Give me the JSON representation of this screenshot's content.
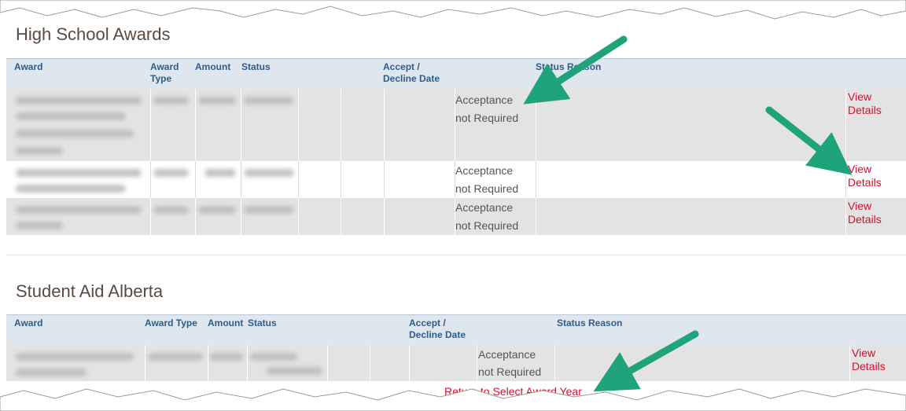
{
  "high_school": {
    "title": "High School Awards",
    "headers": {
      "award": "Award",
      "award_type_1": "Award",
      "award_type_2": "Type",
      "amount": "Amount",
      "status": "Status",
      "accept_1": "Accept /",
      "accept_2": "Decline Date",
      "status_reason": "Status Reason"
    },
    "rows": [
      {
        "acceptance_1": "Acceptance",
        "acceptance_2": "not Required",
        "link_1": "View",
        "link_2": "Details"
      },
      {
        "acceptance_1": "Acceptance",
        "acceptance_2": "not Required",
        "link_1": "View",
        "link_2": "Details"
      },
      {
        "acceptance_1": "Acceptance",
        "acceptance_2": "not Required",
        "link_1": "View",
        "link_2": "Details"
      }
    ]
  },
  "student_aid": {
    "title": "Student Aid Alberta",
    "headers": {
      "award": "Award",
      "award_type": "Award Type",
      "amount": "Amount",
      "status": "Status",
      "accept_1": "Accept /",
      "accept_2": "Decline Date",
      "status_reason": "Status Reason"
    },
    "rows": [
      {
        "acceptance_1": "Acceptance",
        "acceptance_2": "not Required",
        "link_1": "View",
        "link_2": "Details"
      }
    ]
  },
  "footer": {
    "return_link": "Return to Select Award Year"
  },
  "colors": {
    "header_bg": "#dfe6ee",
    "header_text": "#2f5d8a",
    "link": "#d0102c",
    "arrow": "#1fa37a",
    "title": "#5b4a3f"
  }
}
